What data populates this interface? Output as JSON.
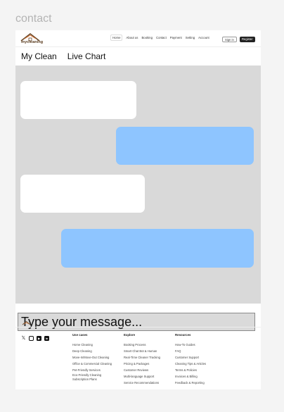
{
  "frame_label": "contact",
  "header": {
    "logo_text": "mycleaning",
    "nav": [
      "Home",
      "About us",
      "Booking",
      "Contact",
      "Payment",
      "Setting",
      "Account"
    ],
    "active_index": 0,
    "signin_label": "Sign in",
    "register_label": "Register"
  },
  "subheader": {
    "brand": "My Clean",
    "title": "Live Chart"
  },
  "chat": {
    "input_placeholder": "Type your message...",
    "colors": {
      "incoming": "#ffffff",
      "outgoing": "#8ec5ff",
      "background": "#d9d9d9"
    }
  },
  "footer": {
    "socials": [
      "x-icon",
      "instagram-icon",
      "youtube-icon",
      "linkedin-icon"
    ],
    "columns": [
      {
        "title": "Use cases",
        "items": [
          "Home Cleaning",
          "Deep Cleaning",
          "Move-In/Move-Out Cleaning",
          "Office & Commercial Cleaning",
          "Pet-Friendly Services",
          "Eco-Friendly Cleaning",
          "Subscription Plans"
        ]
      },
      {
        "title": "Explore",
        "items": [
          "Booking Process",
          "Smart Chat Bot & Human",
          "Real-Time Cleaner Tracking",
          "Pricing & Packages",
          "Customer Reviews",
          "Multi-language Support",
          "Service Recommendations"
        ]
      },
      {
        "title": "Resources",
        "items": [
          "How-To Guides",
          "FAQ",
          "Customer Support",
          "Cleaning Tips & Articles",
          "Terms & Policies",
          "Invoices & Billing",
          "Feedback & Reporting"
        ]
      }
    ]
  }
}
